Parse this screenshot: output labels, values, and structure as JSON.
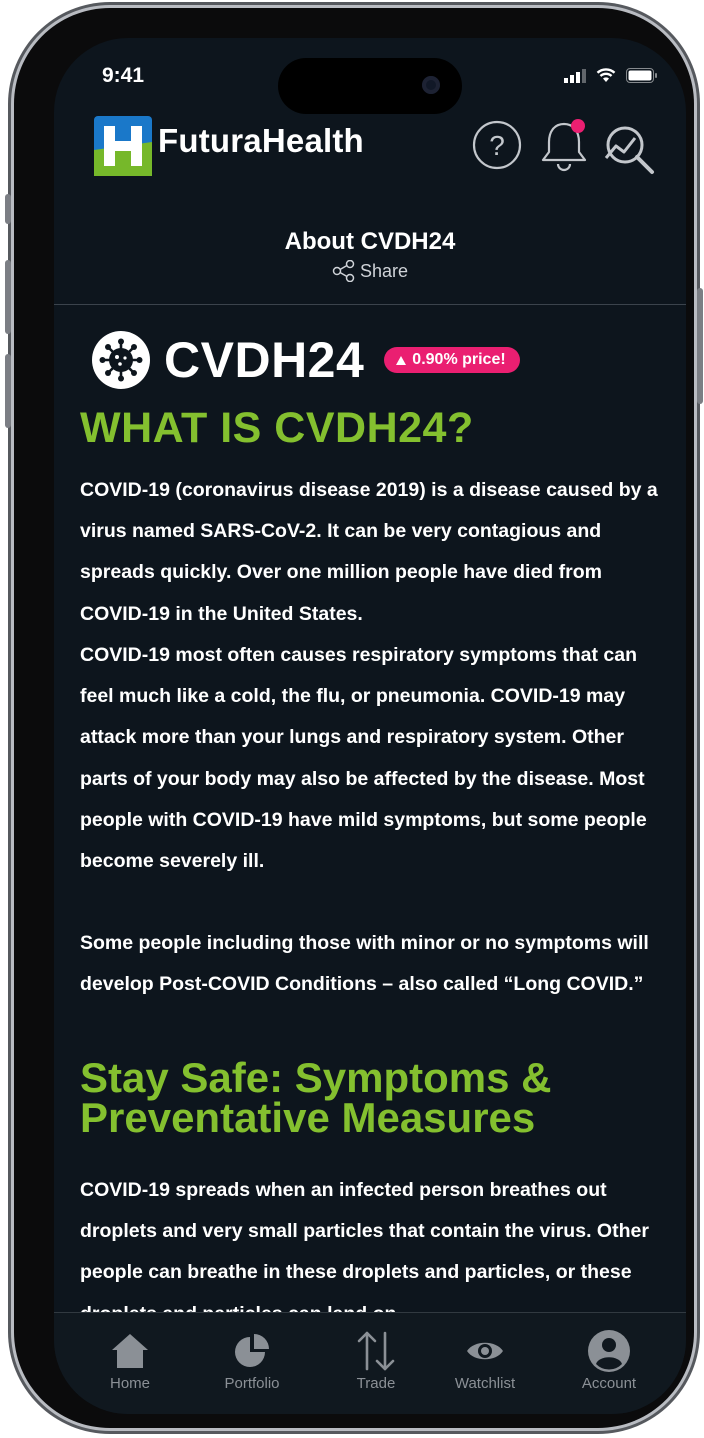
{
  "status_bar": {
    "time": "9:41"
  },
  "header": {
    "brand": "FuturaHealth"
  },
  "page": {
    "title": "About CVDH24",
    "share_label": "Share"
  },
  "ticker": {
    "symbol": "CVDH24",
    "badge": "0.90% price!"
  },
  "about": {
    "heading": "WHAT IS CVDH24?",
    "paragraphs": [
      "COVID-19 (coronavirus disease 2019) is a disease caused by a virus named SARS-CoV-2. It can be very contagious and spreads quickly. Over one million people have died from COVID-19 in the United States.",
      "COVID-19 most often causes respiratory symptoms that can feel much like a cold, the flu, or pneumonia. COVID-19 may attack more than your lungs and respiratory system. Other parts of your body may also be affected by the disease. Most people with COVID-19 have mild symptoms, but some people become severely ill.",
      "Some people including those with minor or no symptoms will develop Post-COVID Conditions – also called “Long COVID.”"
    ]
  },
  "safety": {
    "heading": "Stay Safe: Symptoms & Preventative Measures",
    "paragraph": "COVID-19 spreads when an infected person breathes out droplets and very small particles that contain the virus. Other people can breathe in these droplets and particles, or these droplets and particles can land on"
  },
  "tabs": [
    {
      "label": "Home",
      "icon": "home-icon"
    },
    {
      "label": "Portfolio",
      "icon": "pie-chart-icon"
    },
    {
      "label": "Trade",
      "icon": "arrows-updown-icon"
    },
    {
      "label": "Watchlist",
      "icon": "eye-icon"
    },
    {
      "label": "Account",
      "icon": "account-icon"
    }
  ],
  "colors": {
    "accent_green": "#84c02f",
    "badge_pink": "#ea1f71",
    "logo_blue": "#1a78c9",
    "background": "#0d151d"
  }
}
